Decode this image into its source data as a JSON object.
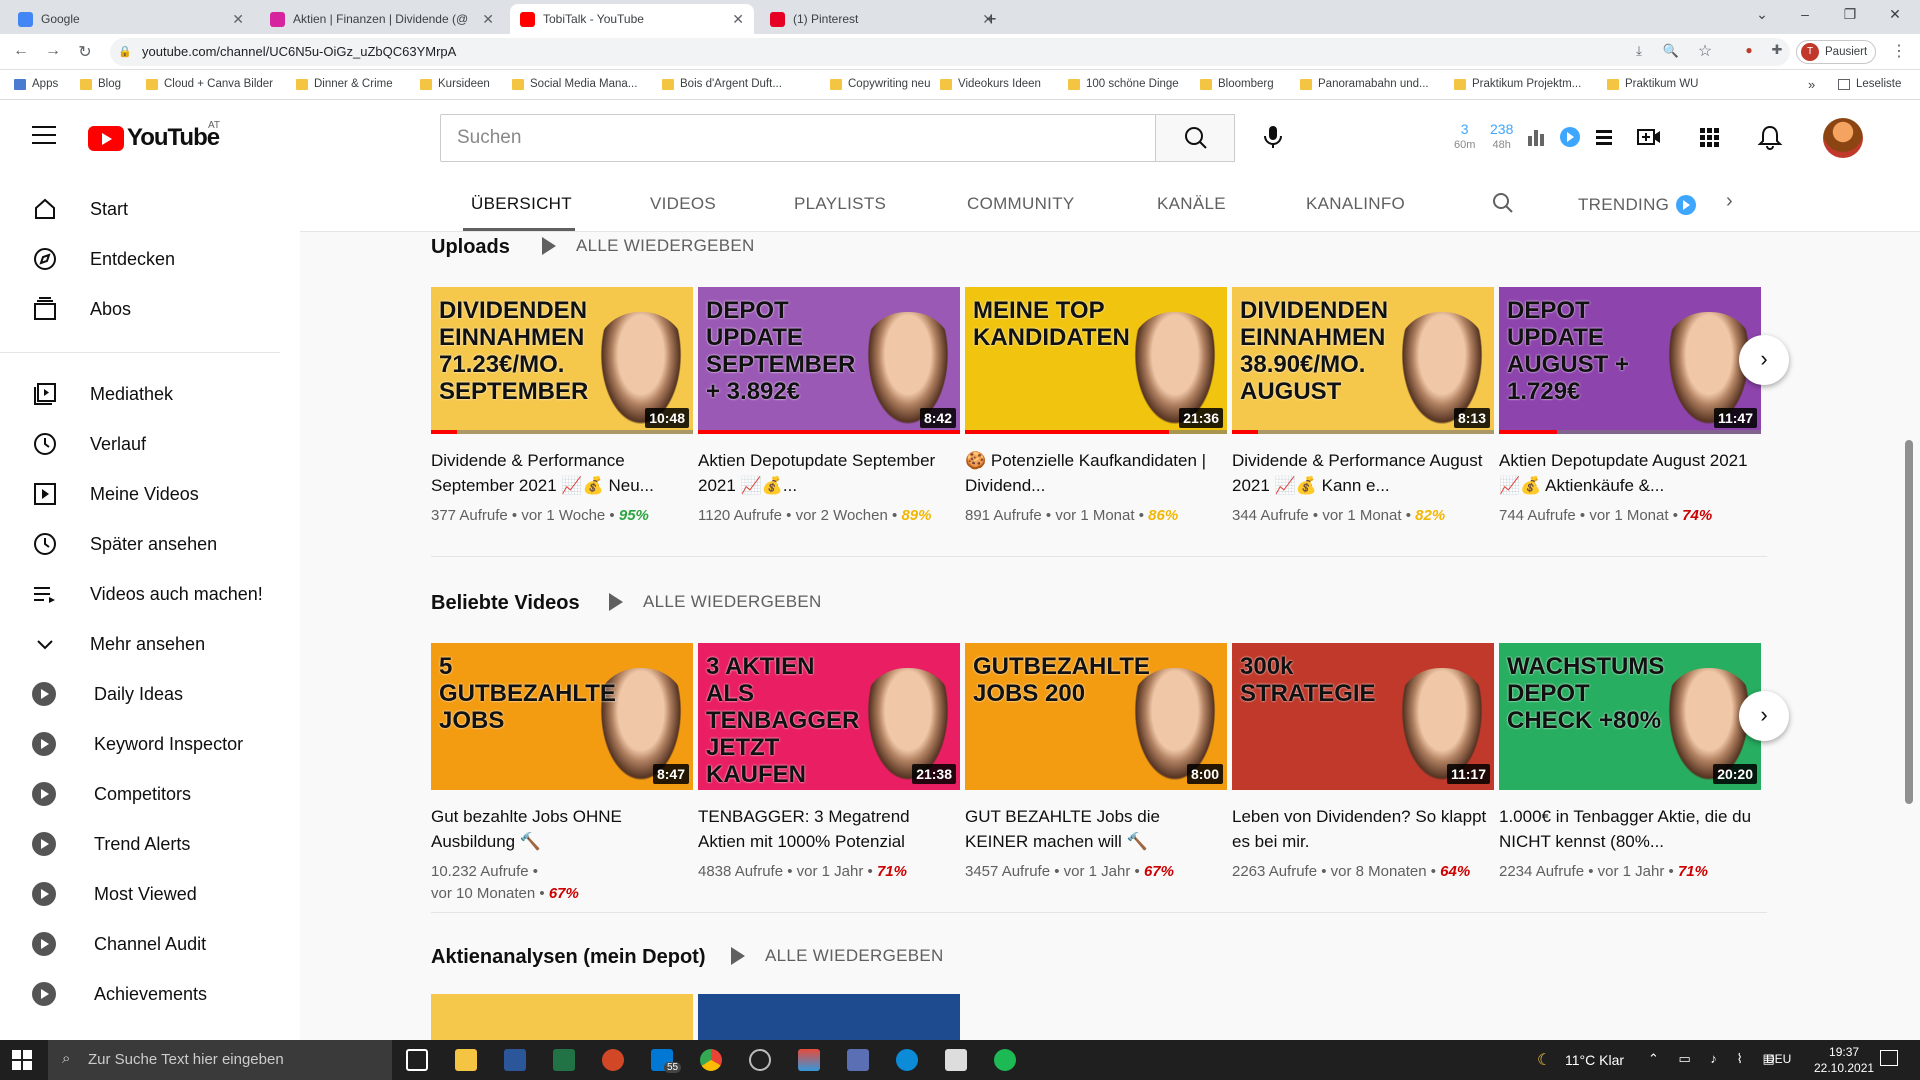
{
  "browser": {
    "tabs": [
      {
        "label": "Google",
        "fav": "#4285f4",
        "active": false
      },
      {
        "label": "Aktien | Finanzen | Dividende (@",
        "fav": "#d6249f",
        "active": false
      },
      {
        "label": "TobiTalk - YouTube",
        "fav": "#ff0000",
        "active": true
      },
      {
        "label": "(1) Pinterest",
        "fav": "#e60023",
        "active": false
      }
    ],
    "url": "youtube.com/channel/UC6N5u-OiGz_uZbQC63YMrpA",
    "profile_status": "Pausiert",
    "bookmarks": [
      "Apps",
      "Blog",
      "Cloud + Canva Bilder",
      "Dinner & Crime",
      "Kursideen",
      "Social Media Mana...",
      "Bois d'Argent Duft...",
      "Copywriting neu",
      "Videokurs Ideen",
      "100 schöne Dinge",
      "Bloomberg",
      "Panoramabahn und...",
      "Praktikum Projektm...",
      "Praktikum WU"
    ],
    "reading_list": "Leseliste"
  },
  "youtube": {
    "logo_text": "YouTube",
    "country": "AT",
    "search_placeholder": "Suchen",
    "stats": [
      {
        "value": "3",
        "label": "60m"
      },
      {
        "value": "238",
        "label": "48h"
      }
    ],
    "sidebar": {
      "main": [
        {
          "label": "Start",
          "icon": "home-icon"
        },
        {
          "label": "Entdecken",
          "icon": "compass-icon"
        },
        {
          "label": "Abos",
          "icon": "subscriptions-icon"
        }
      ],
      "library": [
        {
          "label": "Mediathek",
          "icon": "library-icon"
        },
        {
          "label": "Verlauf",
          "icon": "history-icon"
        },
        {
          "label": "Meine Videos",
          "icon": "my-videos-icon"
        },
        {
          "label": "Später ansehen",
          "icon": "watch-later-icon"
        },
        {
          "label": "Videos auch machen!",
          "icon": "playlist-icon"
        },
        {
          "label": "Mehr ansehen",
          "icon": "chevron-down-icon"
        }
      ],
      "extensions": [
        "Daily Ideas",
        "Keyword Inspector",
        "Competitors",
        "Trend Alerts",
        "Most Viewed",
        "Channel Audit",
        "Achievements"
      ]
    },
    "channel_tabs": [
      "ÜBERSICHT",
      "VIDEOS",
      "PLAYLISTS",
      "COMMUNITY",
      "KANÄLE",
      "KANALINFO"
    ],
    "trending_tab": "TRENDING",
    "sections": [
      {
        "title": "Uploads",
        "play_all": "ALLE WIEDERGEBEN",
        "videos": [
          {
            "thumb_text": "DIVIDENDEN EINNAHMEN 71.23€/MO. SEPTEMBER",
            "thumb_bg": "#f5c84b",
            "duration": "10:48",
            "progress": 0.1,
            "title": "Dividende & Performance September 2021 📈💰 Neu...",
            "views": "377 Aufrufe",
            "age": "vor 1 Woche",
            "pct": "95%",
            "pct_color": "#2ba640"
          },
          {
            "thumb_text": "DEPOT UPDATE SEPTEMBER + 3.892€",
            "thumb_bg": "#9b59b6",
            "duration": "8:42",
            "progress": 1.0,
            "title": "Aktien Depotupdate September 2021 📈💰...",
            "views": "1120 Aufrufe",
            "age": "vor 2 Wochen",
            "pct": "89%",
            "pct_color": "#f2b705"
          },
          {
            "thumb_text": "MEINE TOP KANDIDATEN",
            "thumb_bg": "#f1c40f",
            "duration": "21:36",
            "progress": 0.78,
            "title": "🍪 Potenzielle Kaufkandidaten | Dividend...",
            "views": "891 Aufrufe",
            "age": "vor 1 Monat",
            "pct": "86%",
            "pct_color": "#f2b705"
          },
          {
            "thumb_text": "DIVIDENDEN EINNAHMEN 38.90€/MO. AUGUST",
            "thumb_bg": "#f5c84b",
            "duration": "8:13",
            "progress": 0.1,
            "title": "Dividende & Performance August 2021 📈💰 Kann e...",
            "views": "344 Aufrufe",
            "age": "vor 1 Monat",
            "pct": "82%",
            "pct_color": "#f2b705"
          },
          {
            "thumb_text": "DEPOT UPDATE AUGUST + 1.729€",
            "thumb_bg": "#8e44ad",
            "duration": "11:47",
            "progress": 0.22,
            "title": "Aktien Depotupdate August 2021 📈💰 Aktienkäufe &...",
            "views": "744 Aufrufe",
            "age": "vor 1 Monat",
            "pct": "74%",
            "pct_color": "#cc0000"
          }
        ]
      },
      {
        "title": "Beliebte Videos",
        "play_all": "ALLE WIEDERGEBEN",
        "videos": [
          {
            "thumb_text": "5 GUTBEZAHLTE JOBS",
            "thumb_bg": "#f39c12",
            "duration": "8:47",
            "progress": 0.0,
            "title": "Gut bezahlte Jobs OHNE Ausbildung 🔨",
            "views": "10.232 Aufrufe",
            "age": "vor 10 Monaten",
            "pct": "67%",
            "pct_color": "#cc0000"
          },
          {
            "thumb_text": "3 AKTIEN ALS TENBAGGER JETZT KAUFEN",
            "thumb_bg": "#e91e63",
            "duration": "21:38",
            "progress": 0.0,
            "title": "TENBAGGER: 3 Megatrend Aktien mit 1000% Potenzial",
            "views": "4838 Aufrufe",
            "age": "vor 1 Jahr",
            "pct": "71%",
            "pct_color": "#cc0000"
          },
          {
            "thumb_text": "GUTBEZAHLTE JOBS 200",
            "thumb_bg": "#f39c12",
            "duration": "8:00",
            "progress": 0.0,
            "title": "GUT BEZAHLTE Jobs die KEINER machen will 🔨",
            "views": "3457 Aufrufe",
            "age": "vor 1 Jahr",
            "pct": "67%",
            "pct_color": "#cc0000"
          },
          {
            "thumb_text": "300k STRATEGIE",
            "thumb_bg": "#c0392b",
            "duration": "11:17",
            "progress": 0.0,
            "title": "Leben von Dividenden? So klappt es bei mir.",
            "views": "2263 Aufrufe",
            "age": "vor 8 Monaten",
            "pct": "64%",
            "pct_color": "#cc0000"
          },
          {
            "thumb_text": "WACHSTUMS DEPOT CHECK +80%",
            "thumb_bg": "#27ae60",
            "duration": "20:20",
            "progress": 0.0,
            "title": "1.000€ in Tenbagger Aktie, die du NICHT kennst (80%...",
            "views": "2234 Aufrufe",
            "age": "vor 1 Jahr",
            "pct": "71%",
            "pct_color": "#cc0000"
          }
        ]
      },
      {
        "title": "Aktienanalysen (mein Depot)",
        "play_all": "ALLE WIEDERGEBEN",
        "videos": []
      }
    ]
  },
  "taskbar": {
    "search_placeholder": "Zur Suche Text hier eingeben",
    "weather": "11°C  Klar",
    "lang": "DEU",
    "time": "19:37",
    "date": "22.10.2021",
    "mail_badge": "55"
  }
}
